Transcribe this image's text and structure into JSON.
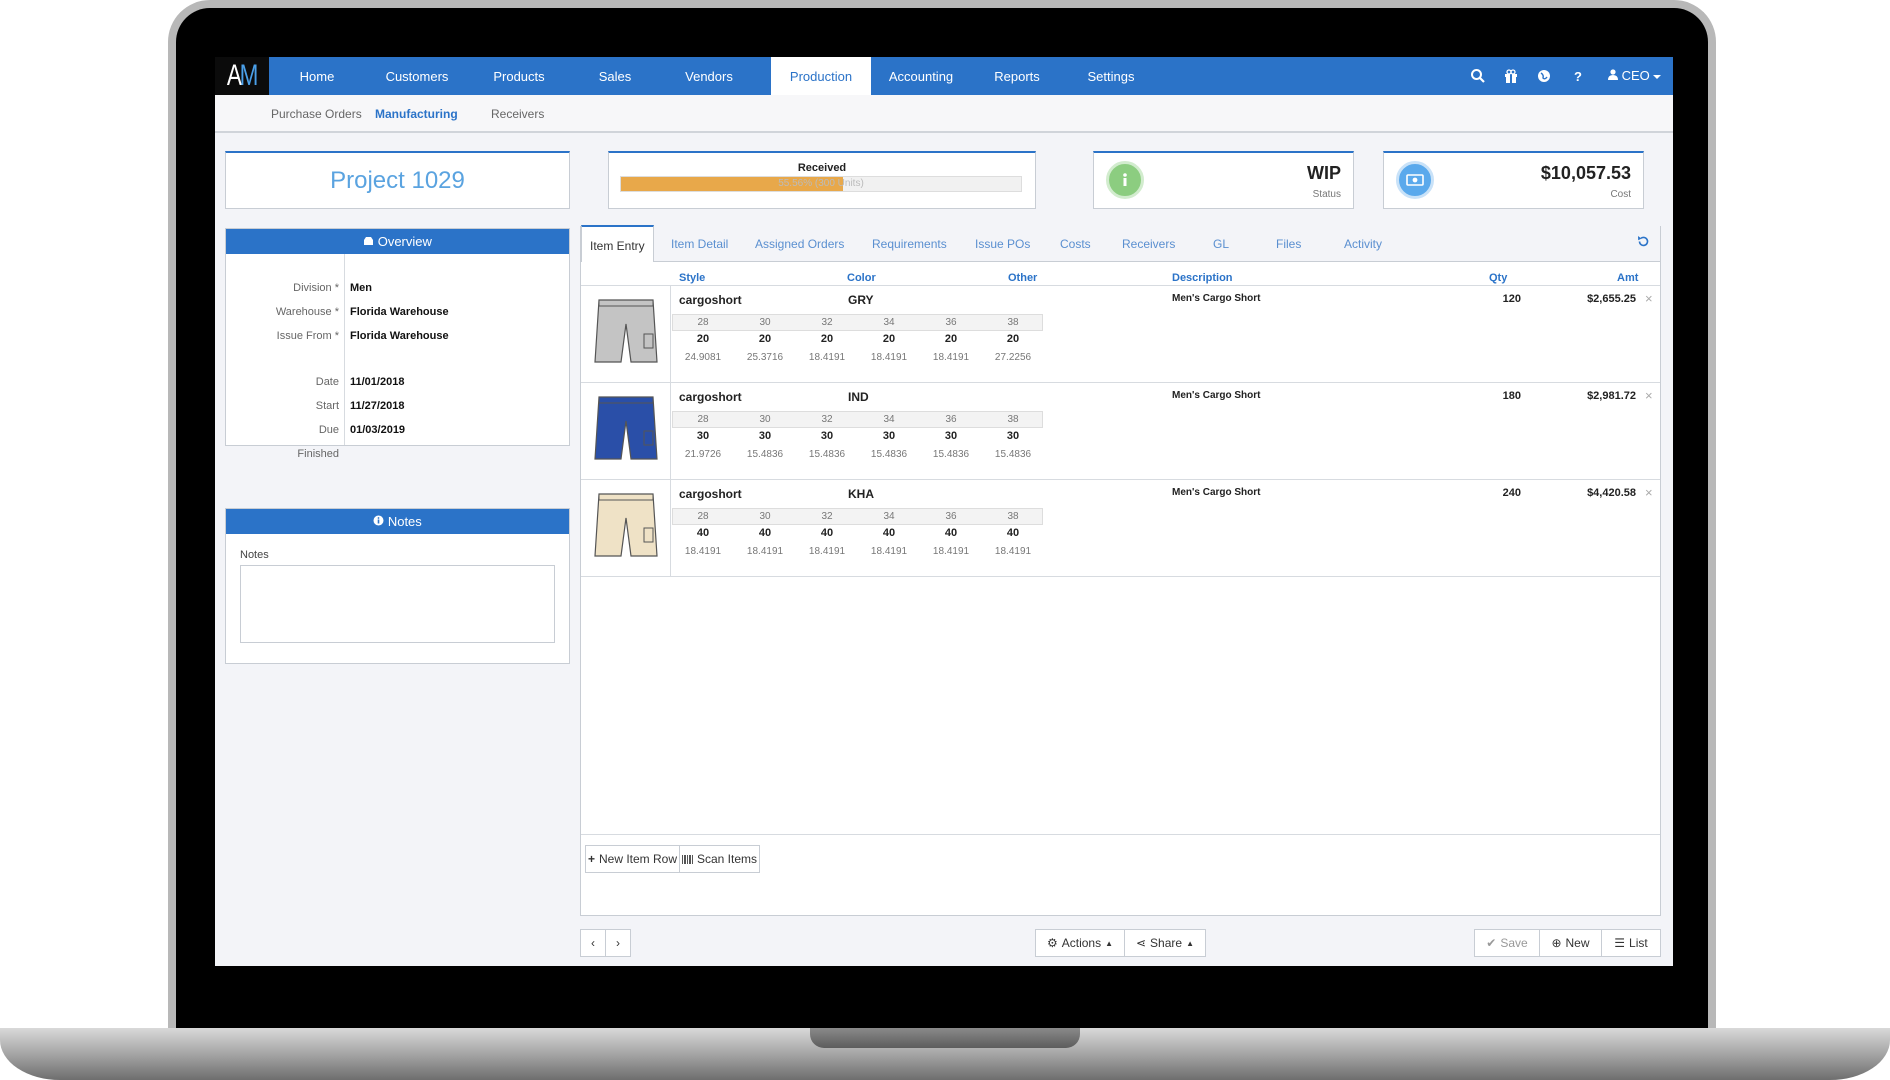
{
  "nav": {
    "logo": "AM",
    "items": [
      "Home",
      "Customers",
      "Products",
      "Sales",
      "Vendors",
      "Production",
      "Accounting",
      "Reports",
      "Settings"
    ],
    "active": "Production",
    "user": "CEO"
  },
  "subnav": {
    "items": [
      "Purchase Orders",
      "Manufacturing",
      "Receivers"
    ],
    "active": "Manufacturing"
  },
  "project": {
    "title": "Project 1029"
  },
  "received": {
    "label": "Received",
    "progress_text": "55.56% (300 Units)",
    "progress": 0.5556
  },
  "status": {
    "value": "WIP",
    "label": "Status"
  },
  "cost": {
    "value": "$10,057.53",
    "label": "Cost"
  },
  "overview": {
    "title": "Overview",
    "division_label": "Division *",
    "division": "Men",
    "warehouse_label": "Warehouse *",
    "warehouse": "Florida Warehouse",
    "issue_label": "Issue From *",
    "issue_from": "Florida Warehouse",
    "date_label": "Date",
    "date": "11/01/2018",
    "start_label": "Start",
    "start": "11/27/2018",
    "due_label": "Due",
    "due": "01/03/2019",
    "finished_label": "Finished"
  },
  "notes": {
    "title": "Notes",
    "field_label": "Notes"
  },
  "tabs": [
    "Item Entry",
    "Item Detail",
    "Assigned Orders",
    "Requirements",
    "Issue POs",
    "Costs",
    "Receivers",
    "GL",
    "Files",
    "Activity"
  ],
  "columns": {
    "style": "Style",
    "color": "Color",
    "other": "Other",
    "description": "Description",
    "qty": "Qty",
    "amt": "Amt"
  },
  "items": [
    {
      "style": "cargoshort",
      "color": "GRY",
      "description": "Men's Cargo Short",
      "qty": "120",
      "amt": "$2,655.25",
      "sizes": [
        "28",
        "30",
        "32",
        "34",
        "36",
        "38"
      ],
      "qtys": [
        "20",
        "20",
        "20",
        "20",
        "20",
        "20"
      ],
      "prices": [
        "24.9081",
        "25.3716",
        "18.4191",
        "18.4191",
        "18.4191",
        "27.2256"
      ],
      "swatch": "#c4c4c4"
    },
    {
      "style": "cargoshort",
      "color": "IND",
      "description": "Men's Cargo Short",
      "qty": "180",
      "amt": "$2,981.72",
      "sizes": [
        "28",
        "30",
        "32",
        "34",
        "36",
        "38"
      ],
      "qtys": [
        "30",
        "30",
        "30",
        "30",
        "30",
        "30"
      ],
      "prices": [
        "21.9726",
        "15.4836",
        "15.4836",
        "15.4836",
        "15.4836",
        "15.4836"
      ],
      "swatch": "#2a4fa8"
    },
    {
      "style": "cargoshort",
      "color": "KHA",
      "description": "Men's Cargo Short",
      "qty": "240",
      "amt": "$4,420.58",
      "sizes": [
        "28",
        "30",
        "32",
        "34",
        "36",
        "38"
      ],
      "qtys": [
        "40",
        "40",
        "40",
        "40",
        "40",
        "40"
      ],
      "prices": [
        "18.4191",
        "18.4191",
        "18.4191",
        "18.4191",
        "18.4191",
        "18.4191"
      ],
      "swatch": "#efe2c6"
    }
  ],
  "buttons": {
    "new_row": "New Item Row",
    "scan": "Scan Items",
    "actions": "Actions",
    "share": "Share",
    "save": "Save",
    "new": "New",
    "list": "List"
  },
  "colors": {
    "brand": "#2b73c8",
    "progress": "#e8a84a",
    "status_icon": "#8ccd80",
    "cost_icon": "#5aa9ec"
  }
}
